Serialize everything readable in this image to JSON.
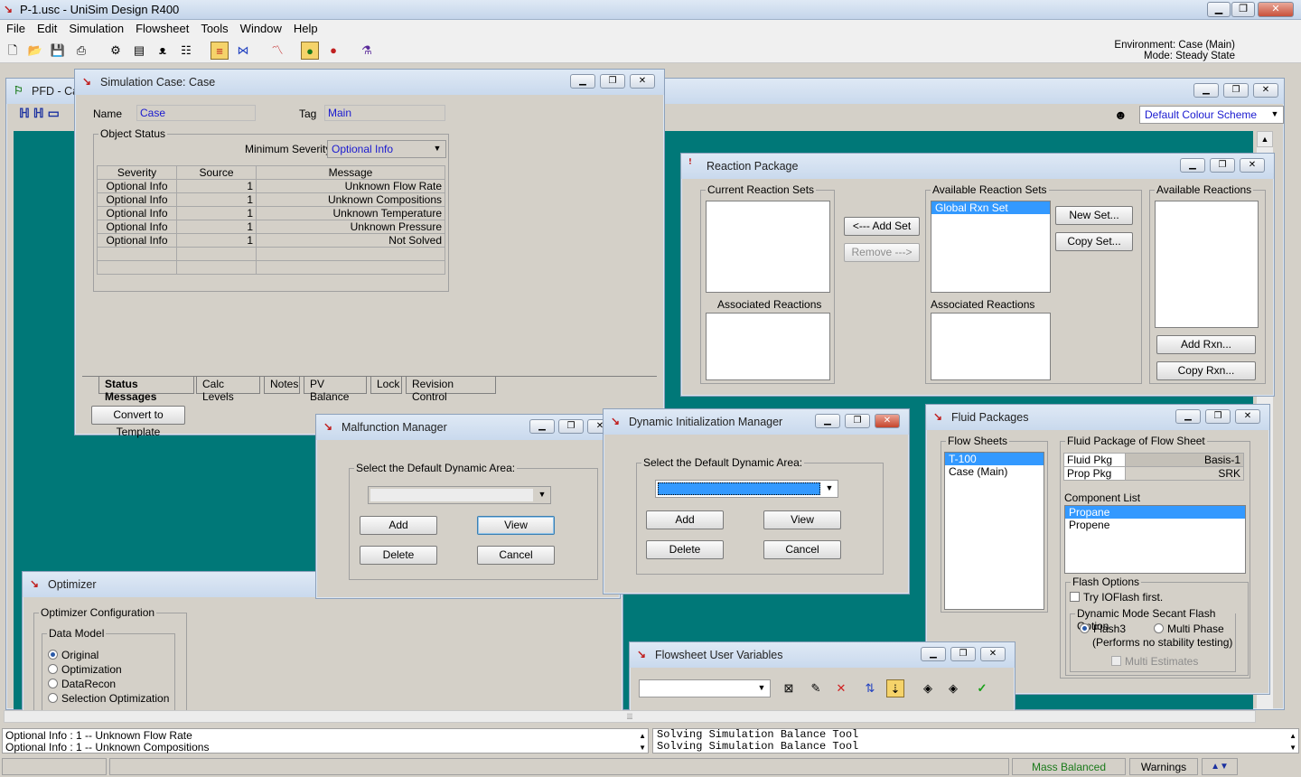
{
  "app": {
    "title": "P-1.usc - UniSim Design R400"
  },
  "menu": [
    "File",
    "Edit",
    "Simulation",
    "Flowsheet",
    "Tools",
    "Window",
    "Help"
  ],
  "environment": {
    "line1": "Environment: Case (Main)",
    "line2": "Mode: Steady State"
  },
  "pfd": {
    "title": "PFD - Cas",
    "colour_scheme": "Default Colour Scheme"
  },
  "sim_case": {
    "title": "Simulation Case: Case",
    "name_label": "Name",
    "name_value": "Case",
    "tag_label": "Tag",
    "tag_value": "Main",
    "object_status_label": "Object Status",
    "min_severity_label": "Minimum Severity",
    "min_severity_value": "Optional Info",
    "columns": [
      "Severity",
      "Source",
      "Message"
    ],
    "rows": [
      [
        "Optional Info",
        "1",
        "Unknown Flow Rate"
      ],
      [
        "Optional Info",
        "1",
        "Unknown Compositions"
      ],
      [
        "Optional Info",
        "1",
        "Unknown Temperature"
      ],
      [
        "Optional Info",
        "1",
        "Unknown Pressure"
      ],
      [
        "Optional Info",
        "1",
        "Not Solved"
      ]
    ],
    "tabs": [
      "Status Messages",
      "Calc Levels",
      "Notes",
      "PV Balance",
      "Lock",
      "Revision Control"
    ],
    "convert_button": "Convert to Template"
  },
  "reaction": {
    "title": "Reaction Package",
    "current_sets": "Current Reaction Sets",
    "assoc1": "Associated Reactions",
    "add_set": "<--- Add Set",
    "remove": "Remove --->",
    "available_sets": "Available Reaction Sets",
    "global_set": "Global Rxn Set",
    "assoc2": "Associated Reactions",
    "new_set": "New Set...",
    "copy_set": "Copy Set...",
    "available_reactions": "Available Reactions",
    "add_rxn": "Add Rxn...",
    "copy_rxn": "Copy Rxn..."
  },
  "malfunction": {
    "title": "Malfunction Manager",
    "group_label": "Select the Default Dynamic Area:",
    "add": "Add",
    "view": "View",
    "delete": "Delete",
    "cancel": "Cancel"
  },
  "dyninit": {
    "title": "Dynamic Initialization Manager",
    "group_label": "Select the Default Dynamic Area:",
    "add": "Add",
    "view": "View",
    "delete": "Delete",
    "cancel": "Cancel"
  },
  "fluid": {
    "title": "Fluid Packages",
    "flow_sheets_label": "Flow Sheets",
    "flow_sheets": [
      "T-100",
      "Case (Main)"
    ],
    "pkg_label": "Fluid Package of Flow Sheet",
    "fluid_pkg_label": "Fluid Pkg",
    "fluid_pkg_value": "Basis-1",
    "prop_pkg_label": "Prop Pkg",
    "prop_pkg_value": "SRK",
    "component_label": "Component List",
    "components": [
      "Propane",
      "Propene"
    ],
    "flash_options": "Flash Options",
    "try_ioflash": "Try IOFlash first.",
    "secant_label": "Dynamic Mode Secant Flash Option",
    "flash3": "Flash3",
    "multi_phase": "Multi Phase",
    "no_stability": "(Performs no stability testing)",
    "multi_estimates": "Multi Estimates"
  },
  "optimizer": {
    "title": "Optimizer",
    "config_label": "Optimizer Configuration",
    "data_model_label": "Data Model",
    "options": [
      "Original",
      "Optimization",
      "DataRecon",
      "Selection Optimization"
    ]
  },
  "fsvars": {
    "title": "Flowsheet User Variables"
  },
  "messages_left": [
    "Optional Info  : 1 -- Unknown Flow Rate",
    "Optional Info  : 1 -- Unknown Compositions"
  ],
  "messages_right": [
    "Solving Simulation Balance Tool",
    "Solving Simulation Balance Tool"
  ],
  "status": {
    "mass_balanced": "Mass Balanced",
    "warnings": "Warnings"
  },
  "colors": {
    "teal": "#007878",
    "selection": "#3399ff",
    "mass_balanced_text": "#1a7a1a"
  }
}
